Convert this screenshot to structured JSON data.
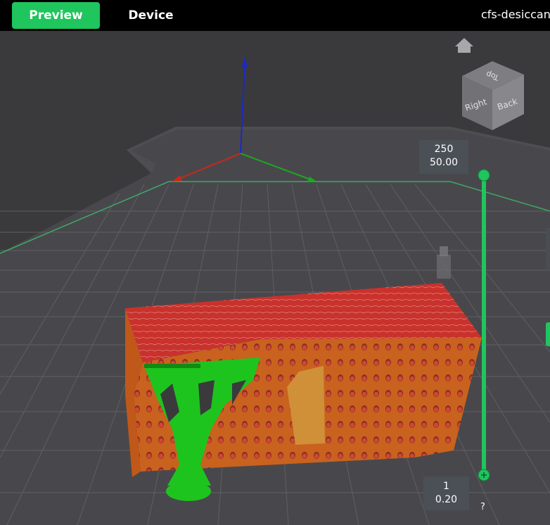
{
  "topbar": {
    "tabs": [
      {
        "label": "Preview",
        "active": true
      },
      {
        "label": "Device",
        "active": false
      }
    ],
    "file_name": "cfs-desiccant"
  },
  "view_cube": {
    "faces": [
      "Top",
      "Right",
      "Back"
    ]
  },
  "layer_slider": {
    "top": {
      "layer": "250",
      "height": "50.00"
    },
    "bottom": {
      "layer": "1",
      "height": "0.20"
    }
  },
  "help_label": "?",
  "colors": {
    "accent": "#1fc55d",
    "topbar": "#000000",
    "background": "#3a3a3d",
    "model_wall": "#c8621e",
    "model_top": "#c9322c",
    "support": "#1ec41e"
  },
  "icons": [
    "home-icon",
    "view-cube",
    "slider-thumb",
    "plus-icon"
  ]
}
